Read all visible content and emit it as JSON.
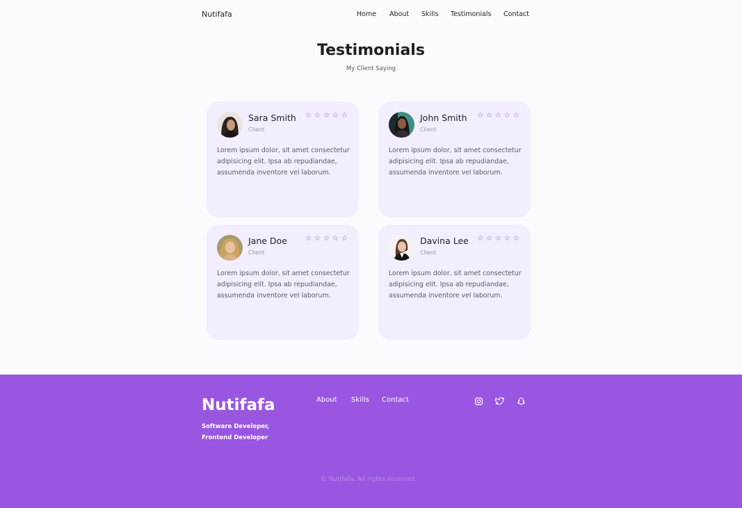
{
  "header": {
    "brand": "Nutifafa",
    "nav": [
      "Home",
      "About",
      "Skills",
      "Testimonials",
      "Contact"
    ]
  },
  "section": {
    "title": "Testimonials",
    "subtitle": "My Client Saying"
  },
  "testimonials": [
    {
      "name": "Sara Smith",
      "role": "Client",
      "rating": 5,
      "text": "Lorem ipsum dolor, sit amet consectetur adipisicing elit. Ipsa ab repudiandae, assumenda inventore vel laborum."
    },
    {
      "name": "John Smith",
      "role": "Client",
      "rating": 5,
      "text": "Lorem ipsum dolor, sit amet consectetur adipisicing elit. Ipsa ab repudiandae, assumenda inventore vel laborum."
    },
    {
      "name": "Jane Doe",
      "role": "Client",
      "rating": 5,
      "text": "Lorem ipsum dolor, sit amet consectetur adipisicing elit. Ipsa ab repudiandae, assumenda inventore vel laborum."
    },
    {
      "name": "Davina Lee",
      "role": "Client",
      "rating": 5,
      "text": "Lorem ipsum dolor, sit amet consectetur adipisicing elit. Ipsa ab repudiandae, assumenda inventore vel laborum."
    }
  ],
  "star_glyph": "☆",
  "footer": {
    "brand": "Nutifafa",
    "description": "Software Developer, Frontend Developer",
    "links": [
      "About",
      "Skills",
      "Contact"
    ],
    "socials": [
      "instagram-icon",
      "twitter-icon",
      "snapchat-icon"
    ],
    "copyright": "© Nutifafa. All rights reserved."
  },
  "colors": {
    "accent": "#9a56e0",
    "card_bg": "#f3eefd",
    "page_bg": "#fbfafd"
  }
}
